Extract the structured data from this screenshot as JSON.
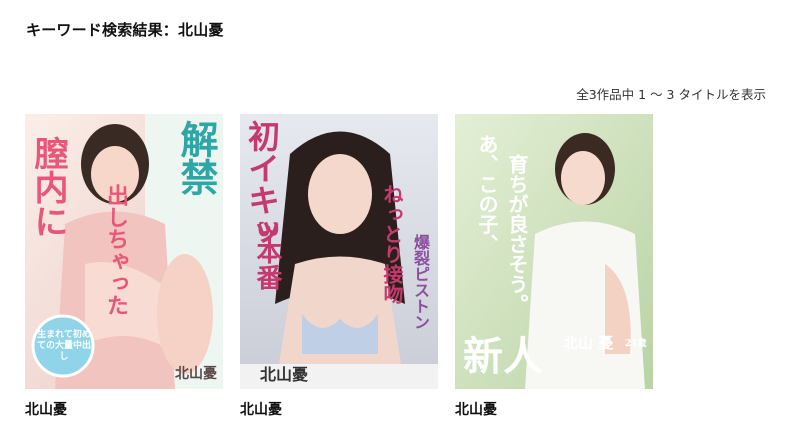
{
  "header": {
    "title": "キーワード検索結果：北山憂"
  },
  "results": {
    "count_text": "全3作品中 1 〜 3 タイトルを表示"
  },
  "items": [
    {
      "title": "北山憂",
      "cover": {
        "big_text_1": "解禁",
        "big_text_2": "膣内に",
        "big_text_3": "出しちゃった",
        "badge_text": "生まれて初めての大量中出し",
        "name_text": "北山憂"
      }
    },
    {
      "title": "北山憂",
      "cover": {
        "big_text_1": "初イキッ",
        "big_text_2": "3本番",
        "big_text_3": "ねっとり接吻",
        "big_text_4": "爆裂ピストン",
        "name_text": "北山憂"
      }
    },
    {
      "title": "北山憂",
      "cover": {
        "big_text_1": "あ、この子、",
        "big_text_2": "育ちが良さそう。",
        "big_text_3": "新人",
        "name_text": "北山 憂",
        "age_text": "21歳"
      }
    }
  ],
  "colors": {
    "cover1_bg": "#f6e2dc",
    "cover1_accent": "#2fa6a6",
    "cover1_pink": "#e8577a",
    "cover2_bg": "#d9dce4",
    "cover2_accent": "#c43a6e",
    "cover3_bg": "#d9e6c8",
    "cover3_accent": "#ffffff"
  }
}
